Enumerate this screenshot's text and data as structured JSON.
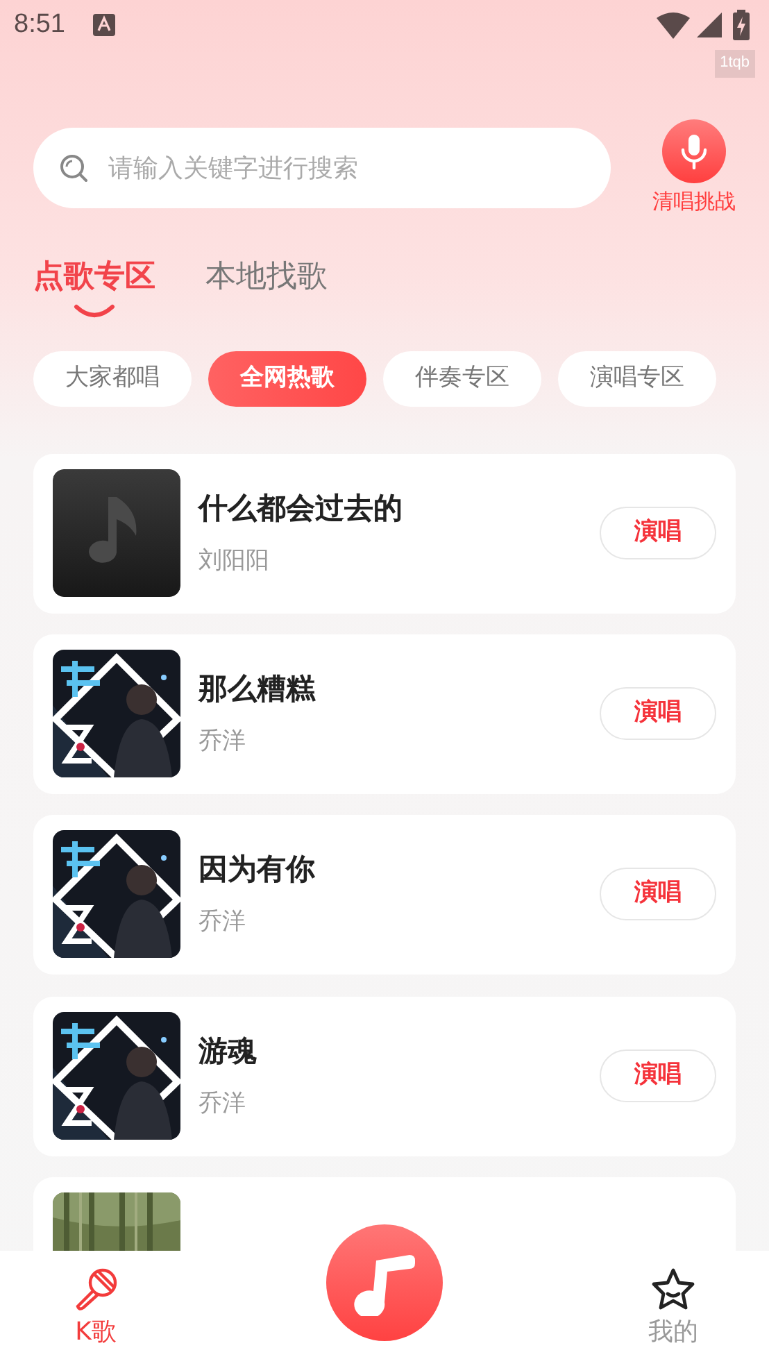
{
  "status_bar": {
    "time": "8:51"
  },
  "badge": "1tqb",
  "search": {
    "placeholder": "请输入关键字进行搜索"
  },
  "mic_button": {
    "label": "清唱挑战"
  },
  "tabs": [
    {
      "label": "点歌专区",
      "selected": true
    },
    {
      "label": "本地找歌",
      "selected": false
    }
  ],
  "chips": [
    {
      "label": "大家都唱",
      "selected": false
    },
    {
      "label": "全网热歌",
      "selected": true
    },
    {
      "label": "伴奏专区",
      "selected": false
    },
    {
      "label": "演唱专区",
      "selected": false
    }
  ],
  "songs": [
    {
      "kind": "placeholder",
      "title": "什么都会过去的",
      "artist": "刘阳阳",
      "action": "演唱"
    },
    {
      "kind": "picture",
      "title": "那么糟糕",
      "artist": "乔洋",
      "action": "演唱"
    },
    {
      "kind": "picture",
      "title": "因为有你",
      "artist": "乔洋",
      "action": "演唱"
    },
    {
      "kind": "picture",
      "title": "游魂",
      "artist": "乔洋",
      "action": "演唱"
    },
    {
      "kind": "picture_only"
    }
  ],
  "bottom_nav": [
    {
      "kind": "tab",
      "label": "K歌",
      "selected": true
    },
    {
      "kind": "center"
    },
    {
      "kind": "tab",
      "label": "我的",
      "selected": false
    }
  ]
}
